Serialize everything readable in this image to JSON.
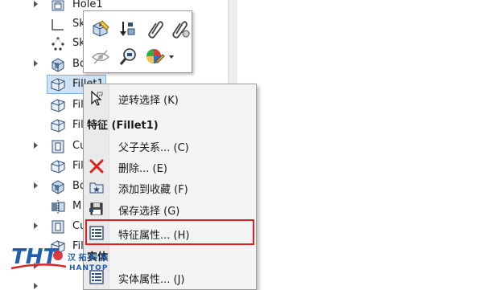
{
  "tree": {
    "items": [
      {
        "label": "Hole1",
        "icon": "hole-feature-icon",
        "expander": true
      },
      {
        "label": "Sk",
        "icon": "sketch-icon",
        "expander": false
      },
      {
        "label": "Sk",
        "icon": "sketch-points-icon",
        "expander": false
      },
      {
        "label": "Bo",
        "icon": "boss-extrude-icon",
        "expander": true
      },
      {
        "label": "Fillet1",
        "icon": "fillet-icon",
        "expander": false,
        "selected": true
      },
      {
        "label": "Fil",
        "icon": "fillet-icon",
        "expander": false
      },
      {
        "label": "Fil",
        "icon": "fillet-icon",
        "expander": false
      },
      {
        "label": "Cu",
        "icon": "cut-extrude-icon",
        "expander": true
      },
      {
        "label": "Fil",
        "icon": "fillet-icon",
        "expander": false
      },
      {
        "label": "Bo",
        "icon": "boss-extrude-icon",
        "expander": true
      },
      {
        "label": "M",
        "icon": "mirror-icon",
        "expander": false
      },
      {
        "label": "Cu",
        "icon": "cut-extrude-icon",
        "expander": true
      },
      {
        "label": "Fil",
        "icon": "fillet-icon",
        "expander": false
      }
    ]
  },
  "toolbar": {
    "buttons": [
      {
        "name": "edit-feature-button",
        "icon": "edit-feature-icon"
      },
      {
        "name": "rollback-button",
        "icon": "rollback-icon"
      },
      {
        "name": "parent-child-button",
        "icon": "paperclip-icon"
      },
      {
        "name": "dependents-button",
        "icon": "paperclip-gear-icon"
      },
      {
        "name": "hide-button",
        "icon": "hide-eye-icon"
      },
      {
        "name": "zoom-to-selection-button",
        "icon": "zoom-selection-icon"
      },
      {
        "name": "appearance-button",
        "icon": "appearance-icon"
      }
    ]
  },
  "menu": {
    "items": [
      {
        "label": "逆转选择 (K)",
        "icon": "invert-selection-icon"
      },
      {
        "label": "父子关系... (C)",
        "icon": ""
      },
      {
        "label": "删除... (E)",
        "icon": "delete-icon"
      },
      {
        "label": "添加到收藏 (F)",
        "icon": "add-favorite-icon"
      },
      {
        "label": "保存选择 (G)",
        "icon": "save-selection-icon"
      },
      {
        "label": "特征属性... (H)",
        "icon": "feature-properties-icon"
      },
      {
        "label": "实体属性... (J)",
        "icon": "body-properties-icon"
      }
    ],
    "header_feature": "特征 (Fillet1)",
    "header_body": "实体"
  },
  "watermark": {
    "brand": "THT",
    "cn_text": "汉 拓 科 技",
    "en_text": "HANTOP"
  },
  "colors": {
    "highlight_border": "#e02020",
    "selection_bg": "#cfe3f7",
    "delete_red": "#d9261c",
    "watermark_blue": "#1e5fb4",
    "watermark_red": "#d8262b"
  }
}
